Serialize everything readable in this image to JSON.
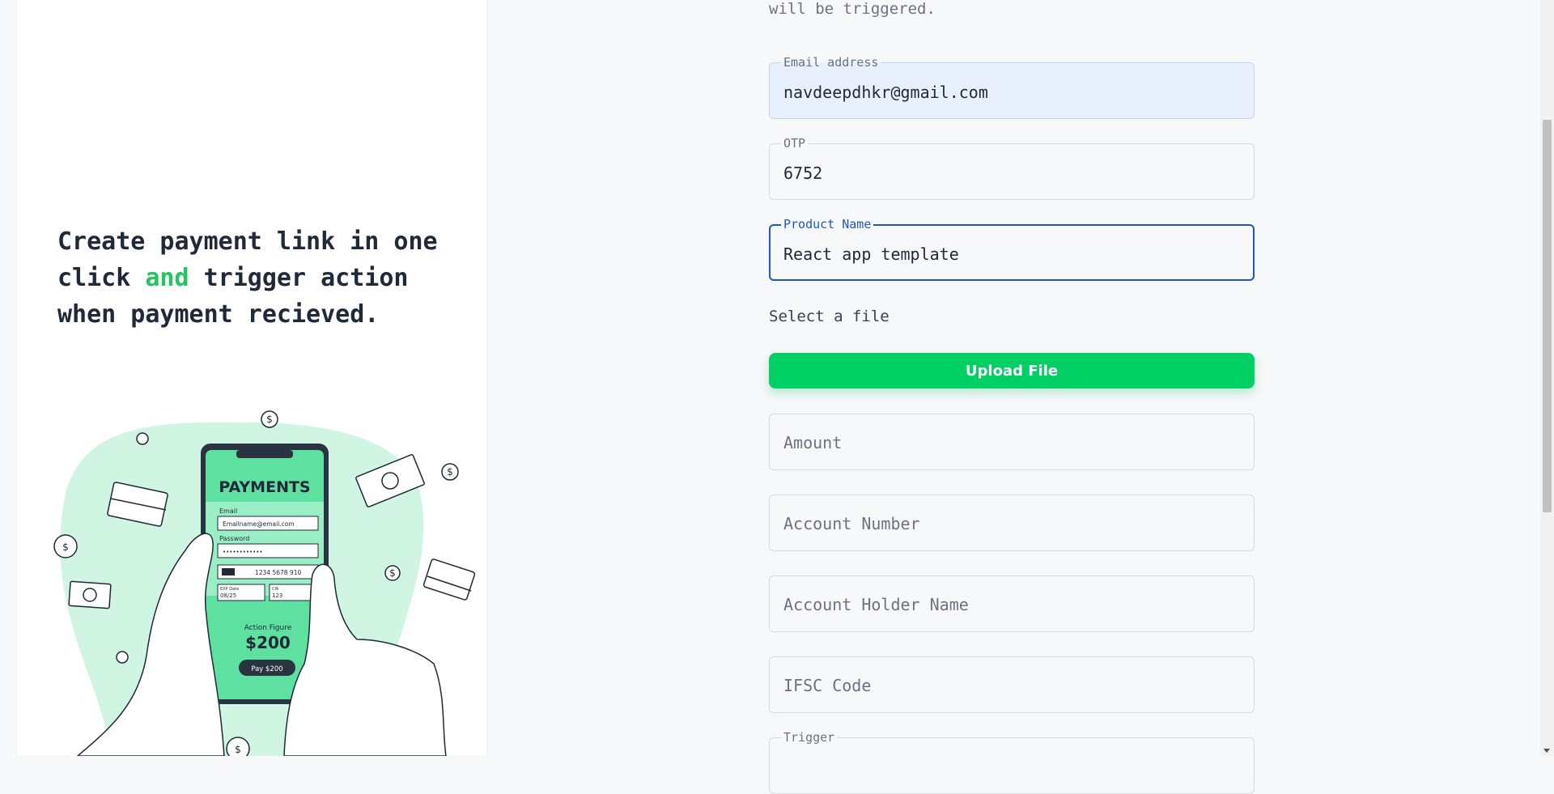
{
  "hero": {
    "headline_part1": "Create payment link in one click ",
    "headline_accent": "and",
    "headline_part2": " trigger action when payment recieved."
  },
  "illustration": {
    "title": "PAYMENTS",
    "email_label": "Email",
    "email_value": "Emailname@email.com",
    "password_label": "Password",
    "password_value": "••••••••••••",
    "card_number": "1234 5678 910",
    "exp_label": "EXP Date",
    "exp_value": "08/25",
    "cvv_label": "CW",
    "cvv_value": "123",
    "product_label": "Action Figure",
    "price": "$200",
    "pay_button": "Pay $200",
    "dollar_symbol": "$"
  },
  "form": {
    "intro_text": "will be triggered.",
    "email_label": "Email address",
    "email_value": "navdeepdhkr@gmail.com",
    "otp_label": "OTP",
    "otp_value": "6752",
    "product_label": "Product Name",
    "product_value": "React app template",
    "file_label": "Select a file",
    "upload_button": "Upload File",
    "amount_placeholder": "Amount",
    "account_number_placeholder": "Account Number",
    "account_holder_placeholder": "Account Holder Name",
    "ifsc_placeholder": "IFSC Code",
    "trigger_label": "Trigger"
  },
  "colors": {
    "accent_green": "#22c55e",
    "button_green": "#00cf63",
    "focus_blue": "#1e56c7",
    "illus_mint": "#d1f5e3",
    "illus_green": "#5ee0a0"
  }
}
